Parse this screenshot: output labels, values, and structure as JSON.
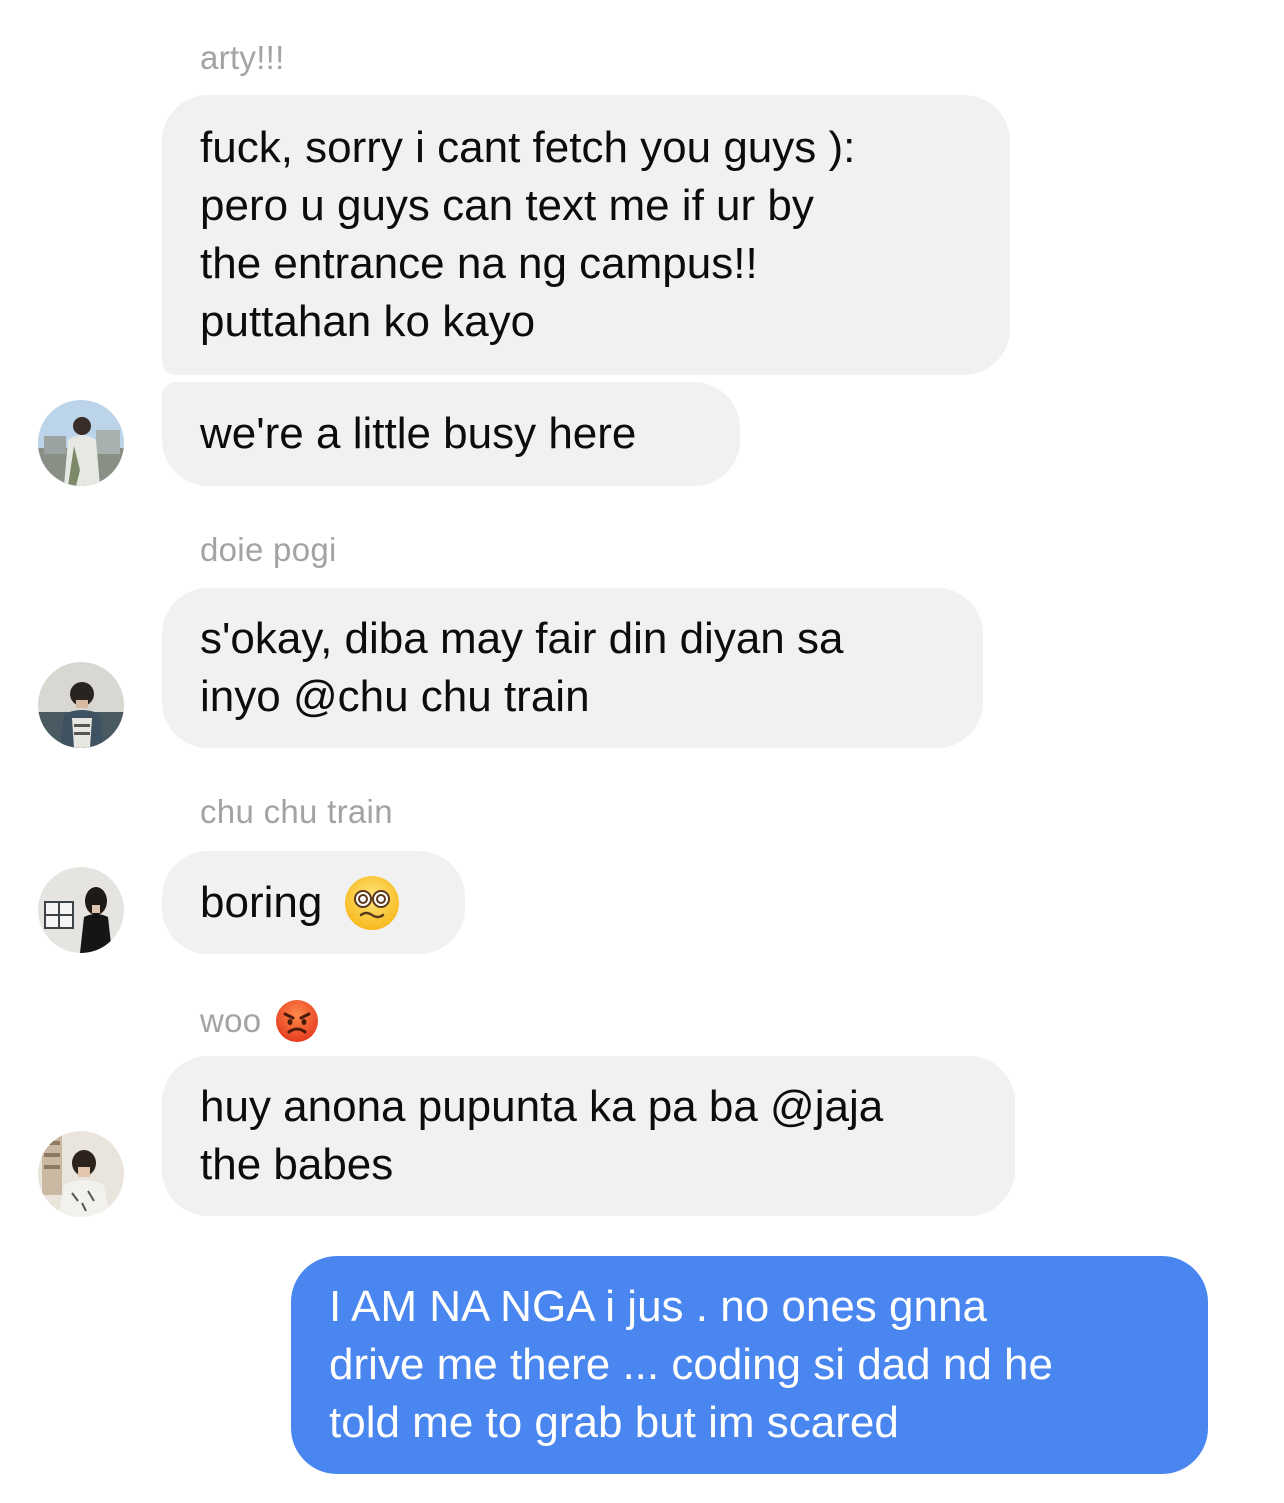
{
  "messages": [
    {
      "sender": "arty!!!",
      "bubbles": [
        "fuck, sorry i cant fetch you guys ):\npero u guys can text me if ur by\nthe entrance na ng campus!!\nputtahan ko kayo",
        "we're a little busy here"
      ]
    },
    {
      "sender": "doie pogi",
      "bubbles": [
        "s'okay, diba may fair din diyan sa\ninyo @chu chu train"
      ]
    },
    {
      "sender": "chu chu train",
      "bubbles": [
        "boring"
      ]
    },
    {
      "sender": "woo",
      "bubbles": [
        "huy anona pupunta ka pa ba @jaja\nthe babes"
      ]
    }
  ],
  "outgoing": {
    "text": "I AM NA NGA i jus . no ones gnna\ndrive me there ... coding si dad nd he\ntold me to grab but im scared"
  },
  "emojis": {
    "dizzy_face": "face-with-spiral-eyes-icon",
    "angry_face": "angry-face-icon"
  },
  "colors": {
    "incoming_bubble": "#f1f1f2",
    "outgoing_bubble": "#4a86f0",
    "sender_name": "#a3a3a6"
  }
}
